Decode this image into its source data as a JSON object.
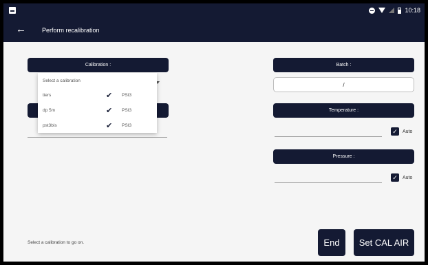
{
  "status_bar": {
    "time": "10:18",
    "icons": [
      "app-notification-icon",
      "do-not-disturb-icon",
      "wifi-icon",
      "signal-icon",
      "battery-icon"
    ]
  },
  "app_bar": {
    "back_icon": "arrow-left-icon",
    "title": "Perform recalibration"
  },
  "calibration": {
    "label": "Calibration :",
    "placeholder": "Select a calibration",
    "options": [
      {
        "name": "tiers",
        "tag": "PSI3"
      },
      {
        "name": "dp 5m",
        "tag": "PSI3"
      },
      {
        "name": "pst3bis",
        "tag": "PSI3"
      }
    ]
  },
  "batch": {
    "label": "Batch :",
    "value": "/"
  },
  "temperature": {
    "label": "Temperature :",
    "auto_label": "Auto",
    "auto_checked": true
  },
  "pressure": {
    "label": "Pressure :",
    "auto_label": "Auto",
    "auto_checked": true
  },
  "footer": {
    "hint": "Select a calibration to go on.",
    "end_label": "End",
    "set_cal_air_label": "Set CAL AIR"
  },
  "colors": {
    "primary": "#141a33",
    "background": "#f5f5f5"
  }
}
